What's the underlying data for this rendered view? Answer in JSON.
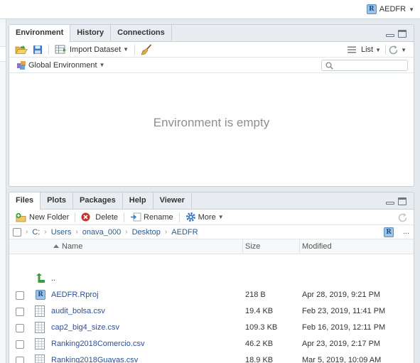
{
  "project": {
    "name": "AEDFR"
  },
  "env_pane": {
    "tabs": [
      {
        "label": "Environment",
        "active": true
      },
      {
        "label": "History",
        "active": false
      },
      {
        "label": "Connections",
        "active": false
      }
    ],
    "toolbar": {
      "import_label": "Import Dataset",
      "list_label": "List"
    },
    "scope_label": "Global Environment",
    "search_placeholder": "",
    "empty_message": "Environment is empty"
  },
  "files_pane": {
    "tabs": [
      {
        "label": "Files",
        "active": true
      },
      {
        "label": "Plots",
        "active": false
      },
      {
        "label": "Packages",
        "active": false
      },
      {
        "label": "Help",
        "active": false
      },
      {
        "label": "Viewer",
        "active": false
      }
    ],
    "toolbar": {
      "new_folder": "New Folder",
      "delete": "Delete",
      "rename": "Rename",
      "more": "More"
    },
    "path": [
      "C:",
      "Users",
      "onava_000",
      "Desktop",
      "AEDFR"
    ],
    "path_more": "...",
    "columns": {
      "name": "Name",
      "size": "Size",
      "modified": "Modified"
    },
    "parent_label": "..",
    "files": [
      {
        "name": "AEDFR.Rproj",
        "size": "218 B",
        "modified": "Apr 28, 2019, 9:21 PM",
        "icon": "rproj-icon"
      },
      {
        "name": "audit_bolsa.csv",
        "size": "19.4 KB",
        "modified": "Feb 23, 2019, 11:41 PM",
        "icon": "csv-file-icon"
      },
      {
        "name": "cap2_big4_size.csv",
        "size": "109.3 KB",
        "modified": "Feb 16, 2019, 12:11 PM",
        "icon": "csv-file-icon"
      },
      {
        "name": "Ranking2018Comercio.csv",
        "size": "46.2 KB",
        "modified": "Apr 23, 2019, 2:17 PM",
        "icon": "csv-file-icon"
      },
      {
        "name": "Ranking2018Guayas.csv",
        "size": "18.9 KB",
        "modified": "Mar 5, 2019, 10:09 AM",
        "icon": "csv-file-icon"
      }
    ]
  }
}
